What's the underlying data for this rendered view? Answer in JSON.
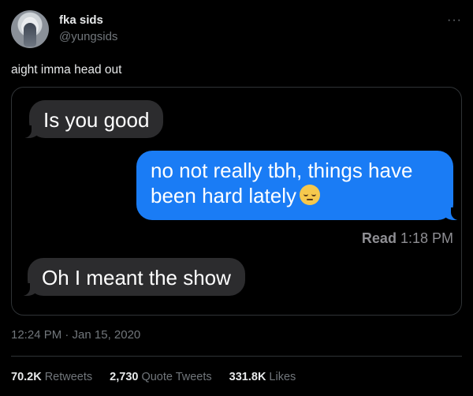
{
  "author": {
    "display_name": "fka sids",
    "handle": "@yungsids"
  },
  "more_menu": "···",
  "tweet": {
    "text": "aight imma head out"
  },
  "screenshot": {
    "messages": [
      {
        "direction": "incoming",
        "text": "Is you good"
      },
      {
        "direction": "outgoing",
        "text": "no not really tbh, things have been hard lately",
        "emoji": "pensive-face"
      },
      {
        "direction": "incoming",
        "text": "Oh I meant the show"
      }
    ],
    "read_receipt": {
      "label": "Read",
      "time": "1:18 PM"
    }
  },
  "timestamp": "12:24 PM · Jan 15, 2020",
  "stats": {
    "retweets": {
      "count": "70.2K",
      "label": "Retweets"
    },
    "quote_tweets": {
      "count": "2,730",
      "label": "Quote Tweets"
    },
    "likes": {
      "count": "331.8K",
      "label": "Likes"
    }
  },
  "colors": {
    "background": "#000000",
    "incoming_bubble": "#2c2c2e",
    "outgoing_bubble": "#1a7cf5",
    "secondary_text": "#71767b"
  }
}
